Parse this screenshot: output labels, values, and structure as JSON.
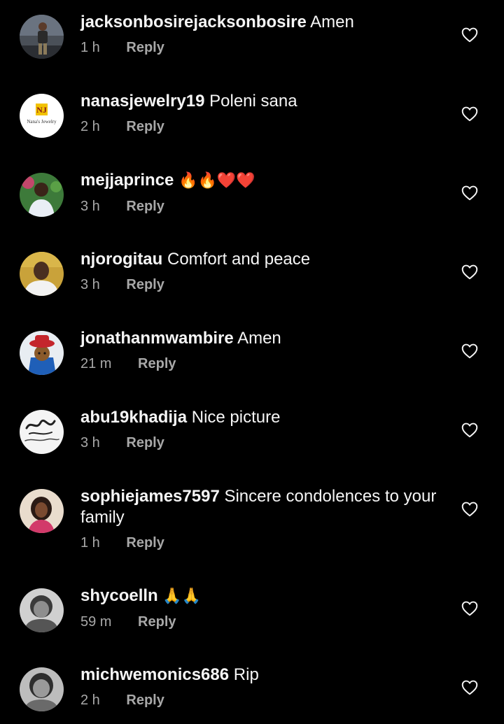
{
  "reply_label": "Reply",
  "colors": {
    "background": "#000000",
    "text": "#f5f5f5",
    "meta": "#a8a8a8"
  },
  "comments": [
    {
      "username": "jacksonbosirejacksonbosire",
      "text": "Amen",
      "emoji": "",
      "time": "1 h",
      "avatar_icon": "person-photo-avatar"
    },
    {
      "username": "nanasjewelry19",
      "text": "Poleni sana",
      "emoji": "",
      "time": "2 h",
      "avatar_icon": "nanas-jewelry-logo-avatar",
      "avatar_logo_text": "NJ",
      "avatar_logo_caption": "Nana's Jewelry"
    },
    {
      "username": "mejjaprince",
      "text": "",
      "emoji": "🔥🔥❤️❤️",
      "time": "3 h",
      "avatar_icon": "person-photo-avatar"
    },
    {
      "username": "njorogitau",
      "text": "Comfort and peace",
      "emoji": "",
      "time": "3 h",
      "avatar_icon": "person-photo-avatar"
    },
    {
      "username": "jonathanmwambire",
      "text": "Amen",
      "emoji": "",
      "time": "21 m",
      "avatar_icon": "paddington-bear-avatar"
    },
    {
      "username": "abu19khadija",
      "text": "Nice picture",
      "emoji": "",
      "time": "3 h",
      "avatar_icon": "calligraphy-avatar"
    },
    {
      "username": "sophiejames7597",
      "text": "Sincere condolences to your family",
      "emoji": "",
      "time": "1 h",
      "avatar_icon": "person-photo-avatar"
    },
    {
      "username": "shycoelln",
      "text": "",
      "emoji": "🙏🙏",
      "time": "59 m",
      "avatar_icon": "person-photo-avatar"
    },
    {
      "username": "michwemonics686",
      "text": "Rip",
      "emoji": "",
      "time": "2 h",
      "avatar_icon": "person-photo-avatar"
    }
  ]
}
